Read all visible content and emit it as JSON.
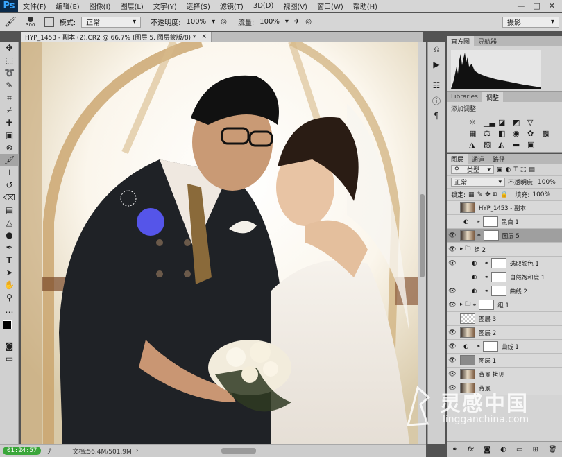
{
  "app": {
    "logo": "Ps"
  },
  "menu": [
    "文件(F)",
    "编辑(E)",
    "图像(I)",
    "图层(L)",
    "文字(Y)",
    "选择(S)",
    "滤镜(T)",
    "3D(D)",
    "视图(V)",
    "窗口(W)",
    "帮助(H)"
  ],
  "window_controls": [
    "—",
    "□",
    "✕"
  ],
  "options": {
    "brush_size": "300",
    "mode_label": "模式:",
    "mode_value": "正常",
    "opacity_label": "不透明度:",
    "opacity_value": "100%",
    "flow_label": "流量:",
    "flow_value": "100%",
    "workspace": "摄影"
  },
  "document": {
    "tab_title": "HYP_1453 - 副本 (2).CR2 @ 66.7% (图层 5, 图层蒙版/8) *",
    "close": "×"
  },
  "status": {
    "timer": "01:24:57",
    "doc_info": "文档:56.4M/501.9M"
  },
  "panels": {
    "histogram_tabs": [
      "直方图",
      "导航器"
    ],
    "adjust_tabs": [
      "Libraries",
      "调整"
    ],
    "adjust_title": "添加调整",
    "layers_tabs": [
      "图层",
      "通道",
      "路径"
    ],
    "layer_filter": "类型",
    "blend_mode": "正常",
    "opacity_label": "不透明度:",
    "opacity_value": "100%",
    "lock_label": "锁定:",
    "fill_label": "填充:",
    "fill_value": "100%"
  },
  "layers": [
    {
      "name": "HYP_1453 - 副本",
      "visible": false,
      "thumb": "photo",
      "mask": false,
      "indent": 0
    },
    {
      "name": "黑白 1",
      "visible": false,
      "thumb": "adjust",
      "mask": true,
      "indent": 0
    },
    {
      "name": "图层 5",
      "visible": true,
      "thumb": "photo",
      "mask": true,
      "indent": 0,
      "selected": true
    },
    {
      "name": "组 2",
      "visible": true,
      "thumb": "folder",
      "mask": false,
      "indent": 0
    },
    {
      "name": "选取颜色 1",
      "visible": true,
      "thumb": "adjust",
      "mask": true,
      "indent": 1
    },
    {
      "name": "自然饱和度 1",
      "visible": false,
      "thumb": "adjust",
      "mask": true,
      "indent": 1
    },
    {
      "name": "曲线 2",
      "visible": true,
      "thumb": "adjust",
      "mask": true,
      "indent": 1
    },
    {
      "name": "组 1",
      "visible": true,
      "thumb": "folder",
      "mask": true,
      "indent": 0
    },
    {
      "name": "图层 3",
      "visible": false,
      "thumb": "transparent",
      "mask": false,
      "indent": 0
    },
    {
      "name": "图层 2",
      "visible": true,
      "thumb": "photo",
      "mask": false,
      "indent": 0
    },
    {
      "name": "曲线 1",
      "visible": true,
      "thumb": "adjust",
      "mask": true,
      "indent": 0
    },
    {
      "name": "图层 1",
      "visible": true,
      "thumb": "gray",
      "mask": false,
      "indent": 0
    },
    {
      "name": "背景 拷贝",
      "visible": true,
      "thumb": "photo",
      "mask": false,
      "indent": 0
    },
    {
      "name": "背景",
      "visible": true,
      "thumb": "photo",
      "mask": false,
      "indent": 0
    }
  ],
  "layers_footer_icons": [
    "link-icon",
    "fx-icon",
    "mask-icon",
    "adjustment-icon",
    "group-icon",
    "new-layer-icon",
    "trash-icon"
  ],
  "watermark": {
    "title": "灵感中国",
    "url": "lingganchina.com"
  },
  "colors": {
    "accent_blue": "#5b5bff",
    "timer_green": "#3aa63a"
  }
}
